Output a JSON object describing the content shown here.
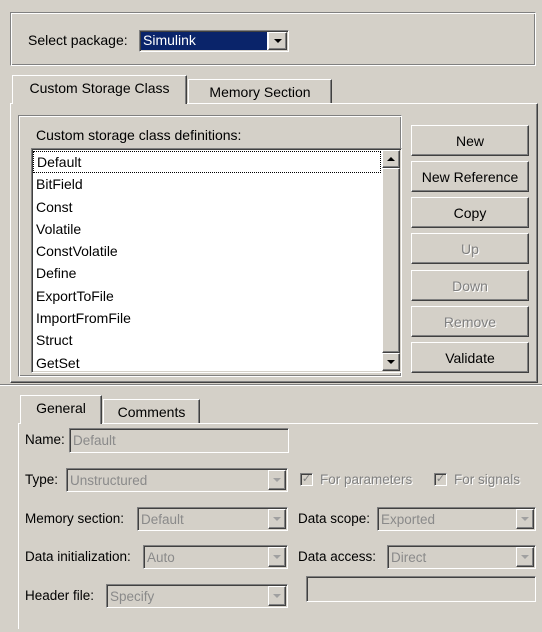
{
  "package": {
    "label": "Select package:",
    "value": "Simulink"
  },
  "top_tabs": [
    {
      "label": "Custom Storage Class"
    },
    {
      "label": "Memory Section"
    }
  ],
  "definitions": {
    "label": "Custom storage class definitions:",
    "items": [
      "Default",
      "BitField",
      "Const",
      "Volatile",
      "ConstVolatile",
      "Define",
      "ExportToFile",
      "ImportFromFile",
      "Struct",
      "GetSet"
    ],
    "selected": "Default"
  },
  "buttons": {
    "new": "New",
    "new_reference": "New Reference",
    "copy": "Copy",
    "up": "Up",
    "down": "Down",
    "remove": "Remove",
    "validate": "Validate"
  },
  "bottom_tabs": [
    {
      "label": "General"
    },
    {
      "label": "Comments"
    }
  ],
  "general": {
    "name_label": "Name:",
    "name_value": "Default",
    "type_label": "Type:",
    "type_value": "Unstructured",
    "for_parameters": "For parameters",
    "for_signals": "For signals",
    "memory_section_label": "Memory section:",
    "memory_section_value": "Default",
    "data_scope_label": "Data scope:",
    "data_scope_value": "Exported",
    "data_init_label": "Data initialization:",
    "data_init_value": "Auto",
    "data_access_label": "Data access:",
    "data_access_value": "Direct",
    "header_file_label": "Header file:",
    "header_file_value": "Specify",
    "header_file_name": ""
  }
}
